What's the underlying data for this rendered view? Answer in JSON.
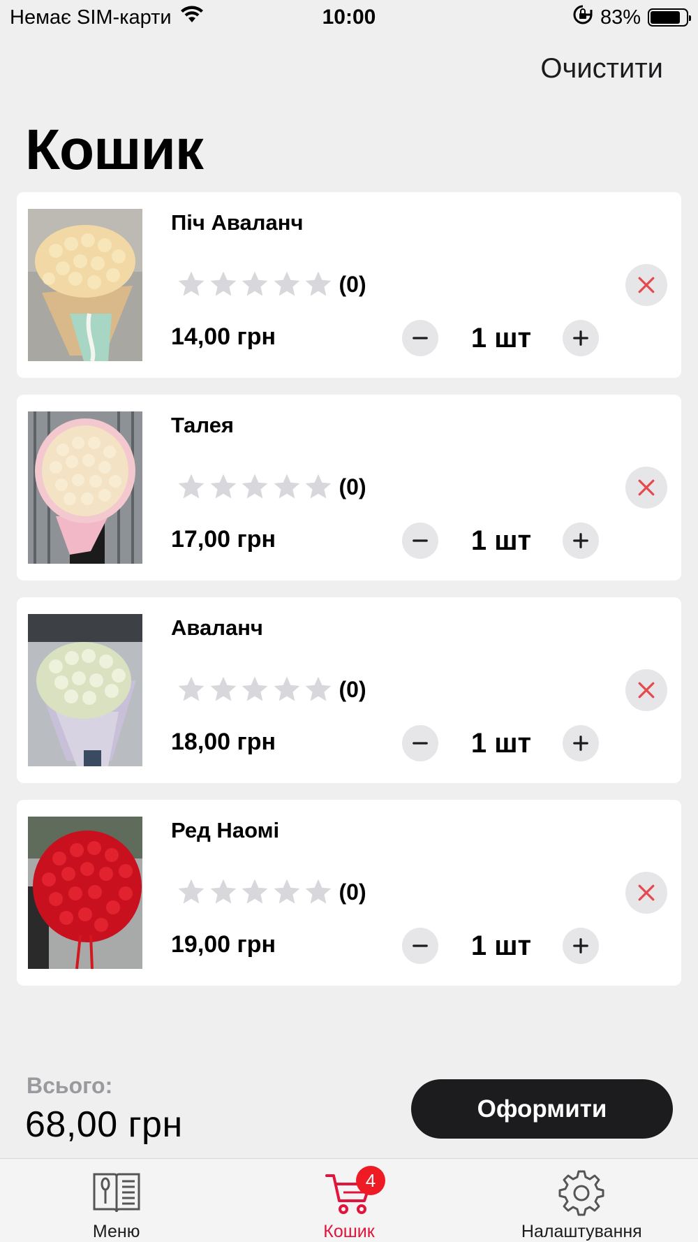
{
  "status_bar": {
    "carrier": "Немає SIM-карти",
    "time": "10:00",
    "battery": "83%",
    "battery_level": 0.83
  },
  "header": {
    "clear_label": "Очистити",
    "title": "Кошик"
  },
  "cart_items": [
    {
      "name": "Піч Аваланч",
      "rating_count": "(0)",
      "price": "14,00 грн",
      "quantity": "1 шт"
    },
    {
      "name": "Талея",
      "rating_count": "(0)",
      "price": "17,00 грн",
      "quantity": "1 шт"
    },
    {
      "name": "Аваланч",
      "rating_count": "(0)",
      "price": "18,00 грн",
      "quantity": "1 шт"
    },
    {
      "name": "Ред Наомі",
      "rating_count": "(0)",
      "price": "19,00 грн",
      "quantity": "1 шт"
    }
  ],
  "summary": {
    "total_label": "Всього:",
    "total_value": "68,00 грн",
    "checkout_label": "Оформити"
  },
  "tab_bar": {
    "tabs": [
      {
        "label": "Меню",
        "icon": "menu-book-icon"
      },
      {
        "label": "Кошик",
        "icon": "cart-icon",
        "badge": "4"
      },
      {
        "label": "Налаштування",
        "icon": "gear-icon"
      }
    ]
  },
  "colors": {
    "accent": "#e1143c",
    "badge": "#ee1b24",
    "remove_icon": "#e5484d",
    "star_empty": "#d7d7dc",
    "button_dark": "#1c1c1e"
  }
}
